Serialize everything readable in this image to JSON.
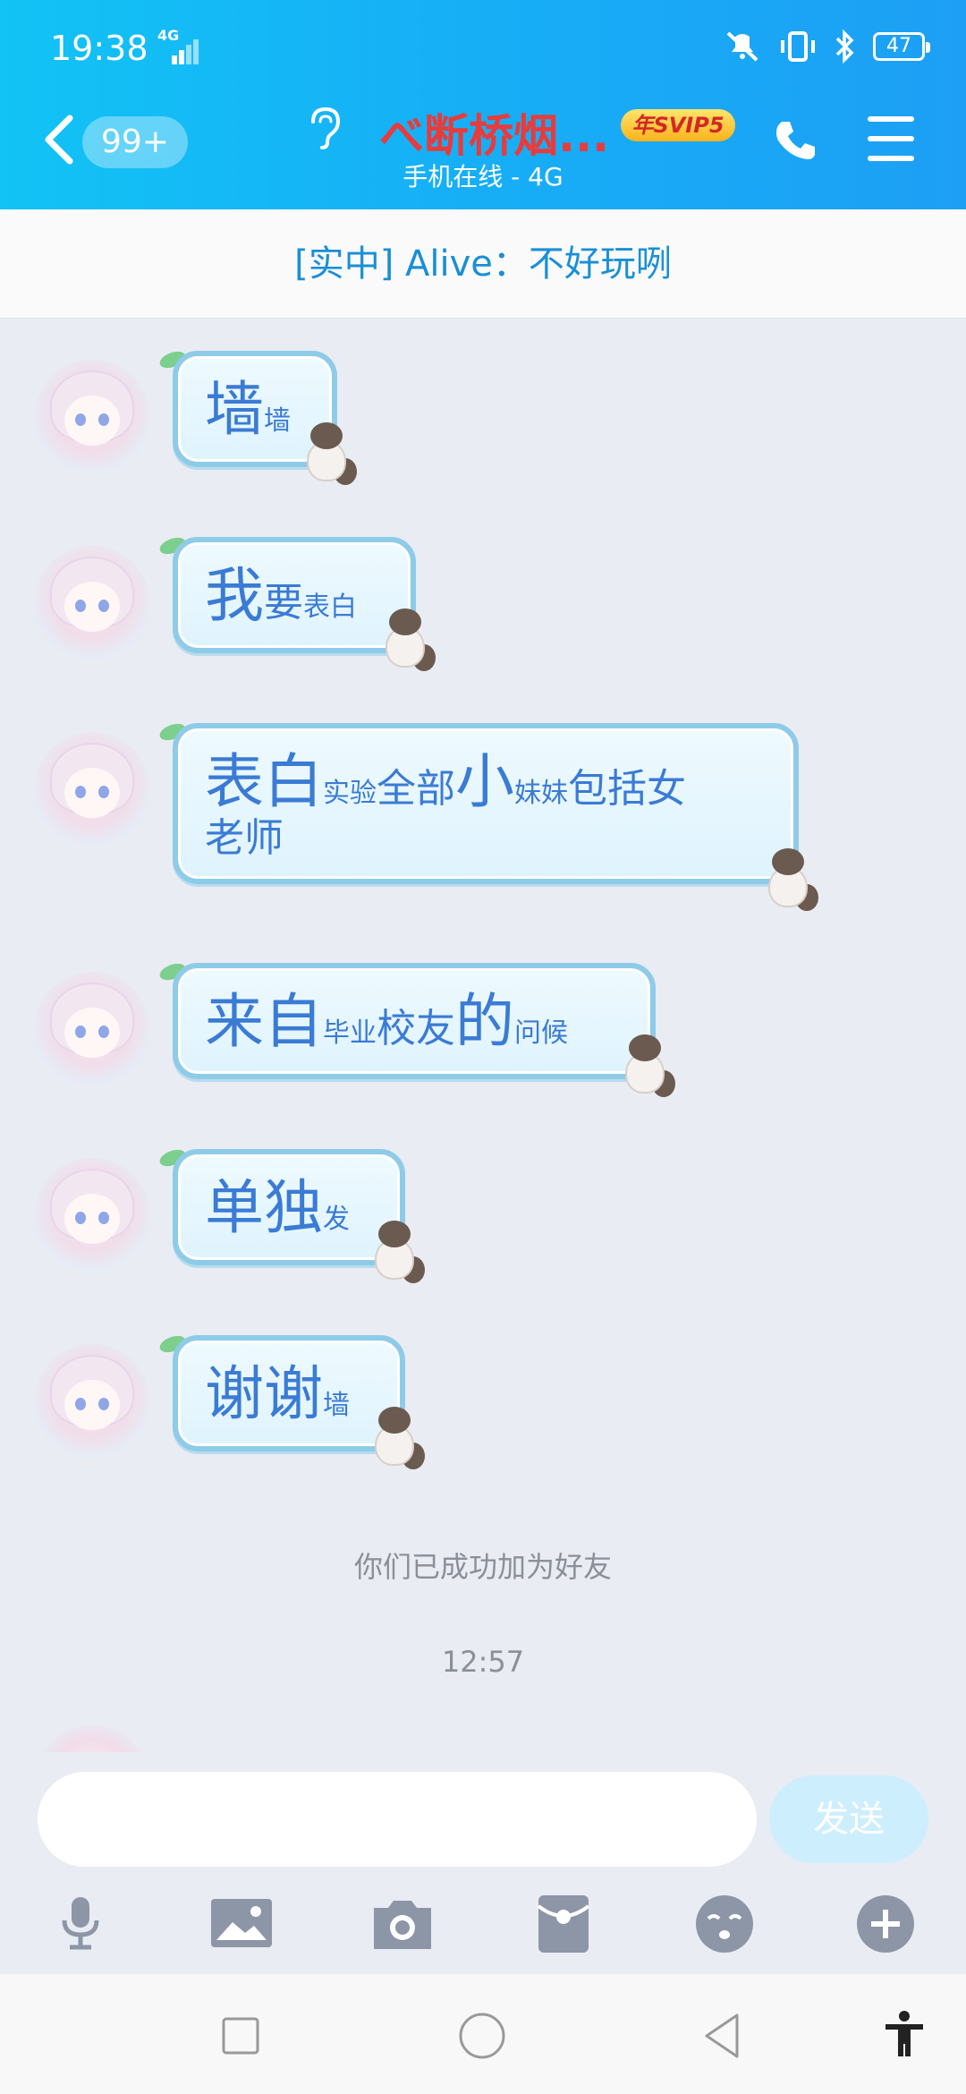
{
  "status_bar": {
    "time": "19:38",
    "network": "4G",
    "battery": "47"
  },
  "header": {
    "unread_badge": "99+",
    "contact_name": "べ断桥烟...",
    "vip_badge": "年SVIP5",
    "online_status": "手机在线 - 4G"
  },
  "notice": {
    "text": "[实中] Alive：不好玩咧"
  },
  "messages": [
    {
      "parts": [
        {
          "t": "墙",
          "s": "big"
        },
        {
          "t": "墙",
          "s": "sm"
        }
      ]
    },
    {
      "parts": [
        {
          "t": "我",
          "s": "big"
        },
        {
          "t": "要",
          "s": "mid"
        },
        {
          "t": "表白",
          "s": "sm"
        }
      ]
    },
    {
      "parts": [
        {
          "t": "表白",
          "s": "big"
        },
        {
          "t": "实验",
          "s": "sm"
        },
        {
          "t": "全部",
          "s": "mid"
        },
        {
          "t": "小",
          "s": "big"
        },
        {
          "t": "妹妹",
          "s": "sm"
        },
        {
          "t": "包括女",
          "s": "mid"
        },
        {
          "t": "老师",
          "s": "mid"
        }
      ]
    },
    {
      "parts": [
        {
          "t": "来自",
          "s": "big"
        },
        {
          "t": "毕业",
          "s": "sm"
        },
        {
          "t": "校友",
          "s": "mid"
        },
        {
          "t": "的",
          "s": "big"
        },
        {
          "t": "问候",
          "s": "sm"
        }
      ]
    },
    {
      "parts": [
        {
          "t": "单独",
          "s": "big"
        },
        {
          "t": "发",
          "s": "sm"
        }
      ]
    },
    {
      "parts": [
        {
          "t": "谢谢",
          "s": "big"
        },
        {
          "t": "墙",
          "s": "sm"
        }
      ]
    }
  ],
  "system": {
    "friend_added": "你们已成功加为好友",
    "timestamp": "12:57"
  },
  "input": {
    "placeholder": "",
    "send_label": "发送"
  },
  "toolbar": {
    "icons": [
      "microphone-icon",
      "image-icon",
      "camera-icon",
      "red-packet-icon",
      "emoji-icon",
      "plus-icon"
    ]
  },
  "colors": {
    "header_gradient_start": "#12c3f5",
    "header_gradient_end": "#1d9ff5",
    "title_red": "#e83b3b",
    "bubble_text": "#3a7bd5",
    "notice_text": "#1a8fd6",
    "send_button": "#cdeefd"
  }
}
